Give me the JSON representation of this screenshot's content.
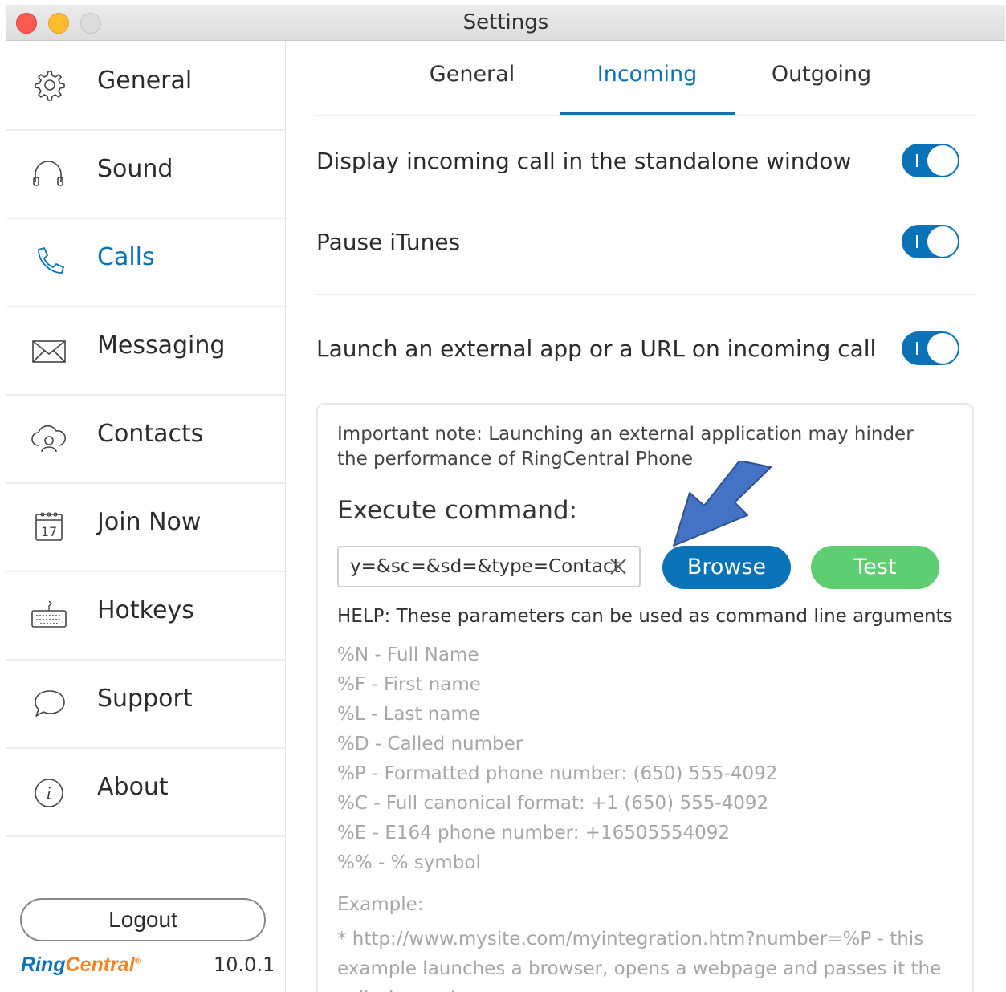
{
  "window": {
    "title": "Settings"
  },
  "sidebar": {
    "items": [
      {
        "label": "General",
        "icon": "gear-icon"
      },
      {
        "label": "Sound",
        "icon": "headphones-icon"
      },
      {
        "label": "Calls",
        "icon": "phone-icon",
        "active": true
      },
      {
        "label": "Messaging",
        "icon": "envelope-icon"
      },
      {
        "label": "Contacts",
        "icon": "contacts-cloud-icon"
      },
      {
        "label": "Join Now",
        "icon": "calendar-icon",
        "icon_text": "17"
      },
      {
        "label": "Hotkeys",
        "icon": "keyboard-icon"
      },
      {
        "label": "Support",
        "icon": "chat-bubble-icon"
      },
      {
        "label": "About",
        "icon": "info-icon",
        "icon_text": "i"
      }
    ],
    "logout_label": "Logout",
    "brand": {
      "part1": "Ring",
      "part2": "Central",
      "mark": "®"
    },
    "version": "10.0.1"
  },
  "tabs": [
    {
      "label": "General"
    },
    {
      "label": "Incoming",
      "active": true
    },
    {
      "label": "Outgoing"
    }
  ],
  "settings": {
    "standalone": {
      "label": "Display incoming call in the standalone window",
      "on": true
    },
    "itunes": {
      "label": "Pause iTunes",
      "on": true
    },
    "external": {
      "label": "Launch an external app or a URL on incoming call",
      "on": true
    }
  },
  "panel": {
    "note": "Important note: Launching an external application may hinder the performance of RingCentral Phone",
    "execute_label": "Execute command:",
    "command_value": "y=&sc=&sd=&type=Contact",
    "browse_label": "Browse",
    "test_label": "Test",
    "help": "HELP: These parameters can be used as command line arguments",
    "params": [
      "%N -  Full Name",
      "%F  -  First name",
      "%L  -  Last name",
      "%D  -  Called number",
      "%P  -  Formatted phone number: (650) 555-4092",
      "%C  -  Full canonical format: +1 (650) 555-4092",
      "%E  -  E164 phone number: +16505554092",
      "%% -  % symbol"
    ],
    "example_label": "Example:",
    "example_text": "* http://www.mysite.com/myintegration.htm?number=%P - this example launches a browser, opens a webpage and passes it the caller’s number"
  },
  "colors": {
    "accent": "#0a73b8",
    "test": "#5fcd72",
    "brand_orange": "#f58220",
    "annotation_arrow": "#4472c4"
  }
}
